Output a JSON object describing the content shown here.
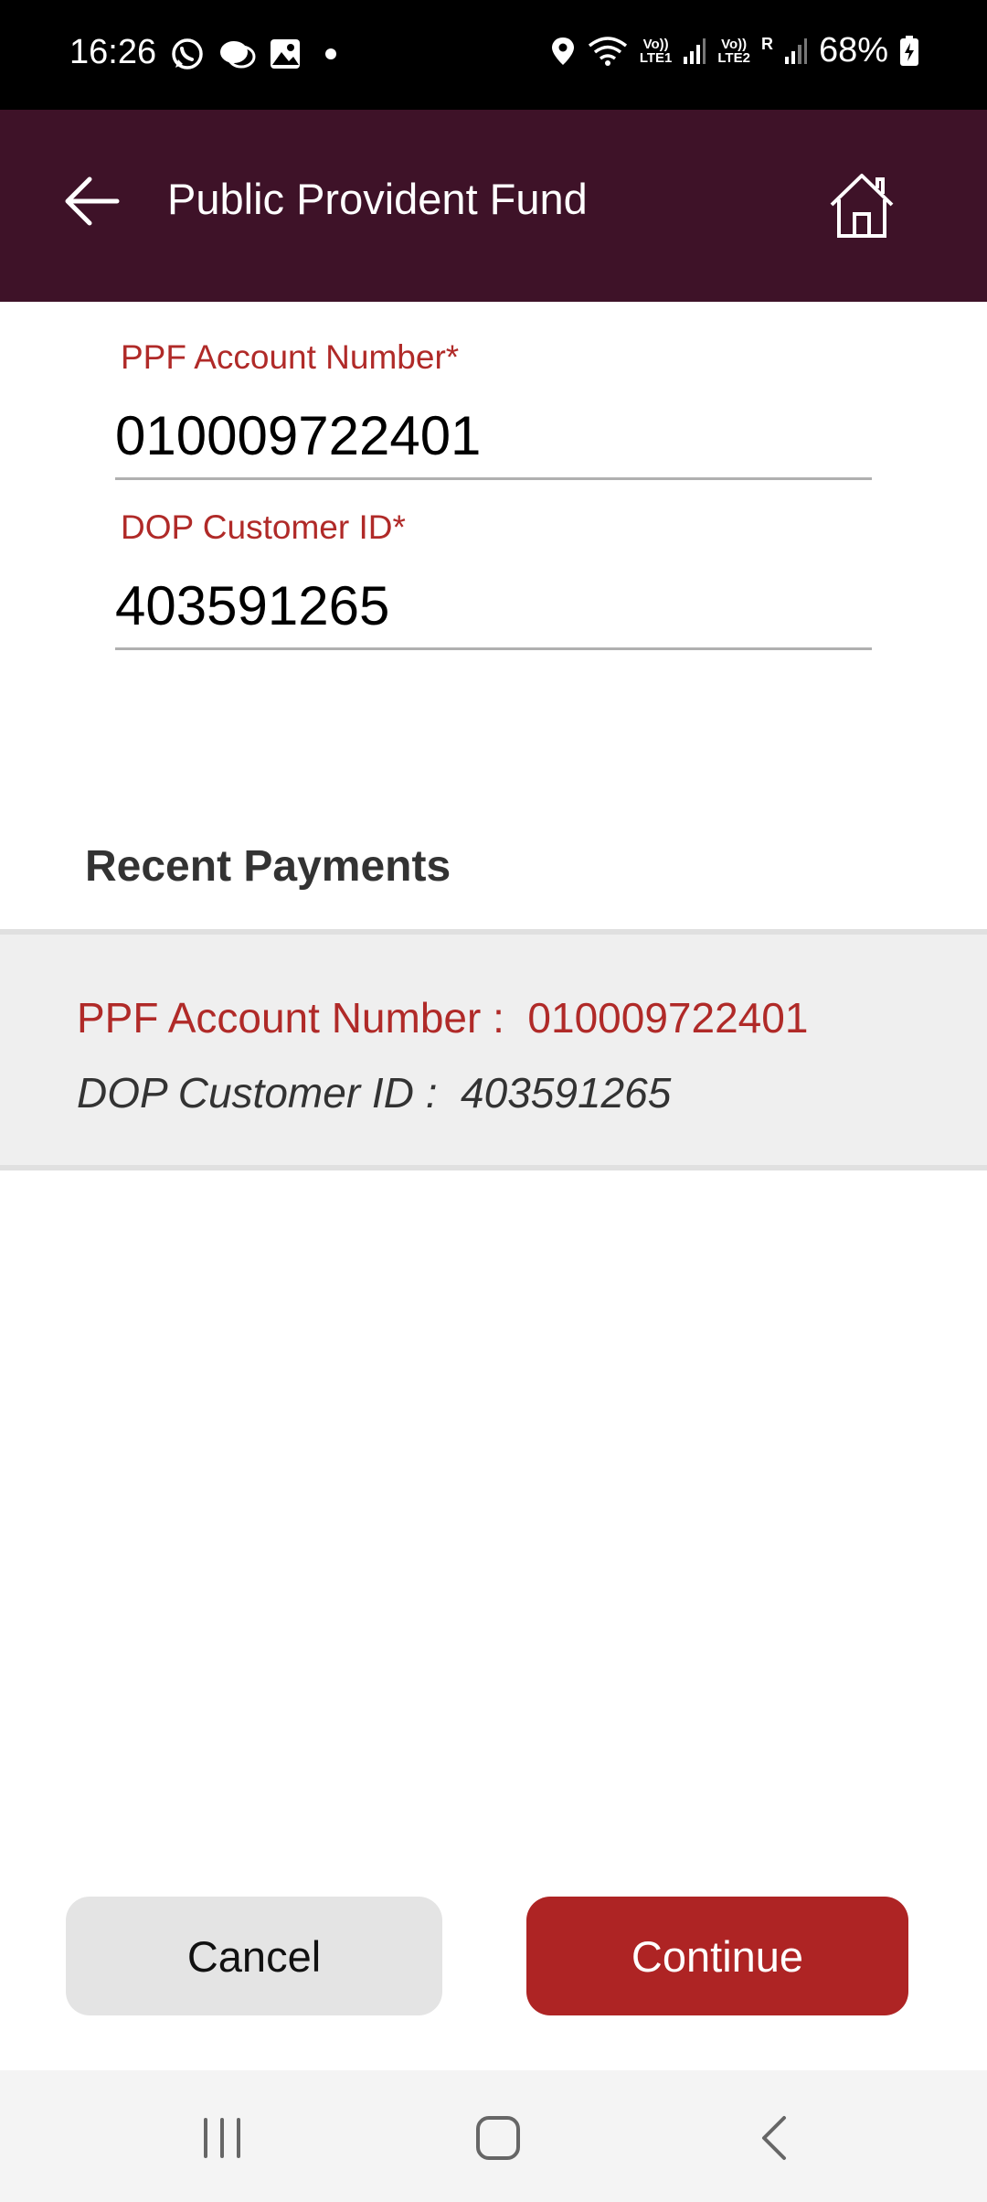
{
  "status_bar": {
    "time": "16:26",
    "battery": "68%",
    "sim1_label": "Vo))\nLTE1",
    "sim2_label": "Vo))\nLTE2",
    "roaming": "R",
    "icons": [
      "whatsapp-icon",
      "chat-icon",
      "gallery-icon",
      "dot-icon",
      "location-icon",
      "wifi-icon",
      "signal-icon",
      "signal-icon",
      "battery-icon"
    ]
  },
  "app_bar": {
    "title": "Public Provident Fund",
    "back_icon": "arrow-left-icon",
    "home_icon": "home-icon"
  },
  "form": {
    "account_label": "PPF Account Number*",
    "account_value": "010009722401",
    "customer_label": "DOP Customer ID*",
    "customer_value": "403591265"
  },
  "recent": {
    "title": "Recent Payments",
    "items": [
      {
        "account_text": "PPF Account Number :  010009722401",
        "customer_text": "DOP Customer ID :  403591265"
      }
    ]
  },
  "actions": {
    "cancel_label": "Cancel",
    "continue_label": "Continue"
  },
  "colors": {
    "app_bar": "#3e1228",
    "accent": "#ae2424",
    "label": "#b02a28"
  }
}
